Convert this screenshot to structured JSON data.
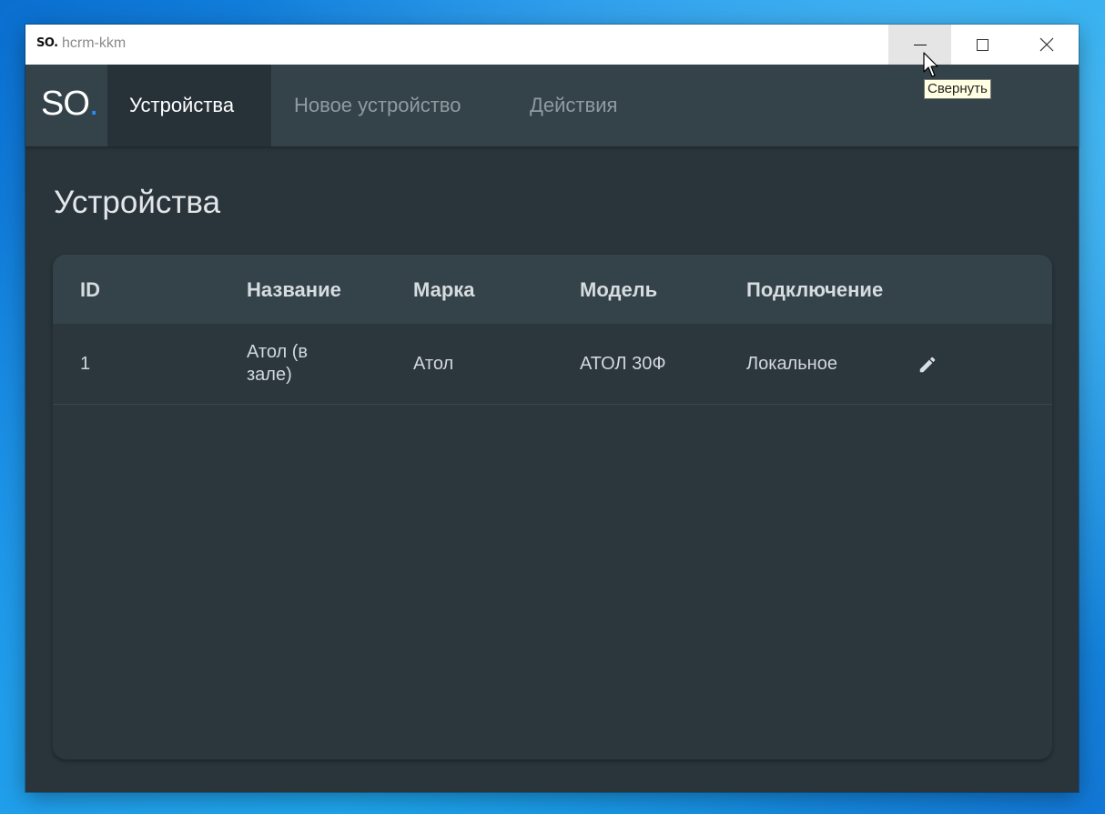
{
  "window": {
    "logo": "SO.",
    "title": "hcrm-kkm"
  },
  "navbar": {
    "brand": "SO",
    "brand_dot": ".",
    "tabs": [
      {
        "label": "Устройства",
        "active": true
      },
      {
        "label": "Новое устройство",
        "active": false
      },
      {
        "label": "Действия",
        "active": false
      }
    ]
  },
  "page": {
    "title": "Устройства"
  },
  "table": {
    "columns": [
      "ID",
      "Название",
      "Марка",
      "Модель",
      "Подключение"
    ],
    "rows": [
      {
        "id": "1",
        "name": "Атол (в зале)",
        "brand": "Атол",
        "model": "АТОЛ 30Ф",
        "connection": "Локальное",
        "action_icon": "pencil-icon"
      }
    ]
  },
  "tooltip": {
    "text": "Свернуть"
  },
  "colors": {
    "accent": "#2a8cff",
    "navbar": "#34434a",
    "background": "#29343b"
  }
}
